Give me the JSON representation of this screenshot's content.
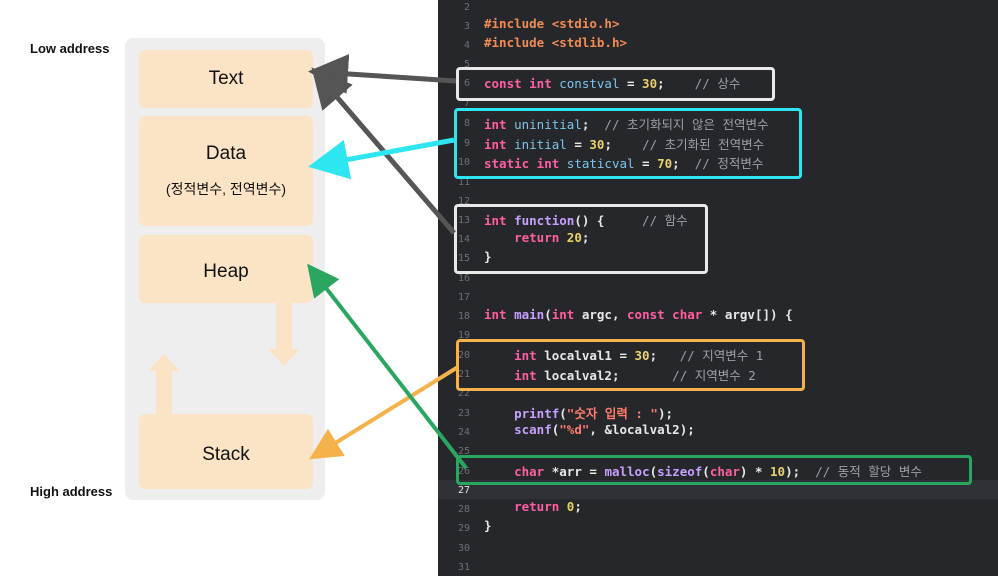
{
  "labels": {
    "low_address": "Low address",
    "high_address": "High address"
  },
  "segments": {
    "text": "Text",
    "data": "Data",
    "data_sub": "(정적변수, 전역변수)",
    "heap": "Heap",
    "stack": "Stack"
  },
  "code": {
    "line_numbers": [
      "2",
      "3",
      "4",
      "5",
      "6",
      "7",
      "8",
      "9",
      "10",
      "11",
      "12",
      "13",
      "14",
      "15",
      "16",
      "17",
      "18",
      "19",
      "20",
      "21",
      "22",
      "23",
      "24",
      "25",
      "26",
      "27",
      "28",
      "29",
      "30",
      "31"
    ],
    "include1": [
      "#include ",
      "<stdio.h>"
    ],
    "include2": [
      "#include ",
      "<stdlib.h>"
    ],
    "l6": {
      "kw": "const int",
      "var": " constval",
      "eq": " = ",
      "num": "30",
      "end": ";",
      "cm": "    // 상수"
    },
    "l8": {
      "kw": "int",
      "var": " uninitial",
      "end": ";",
      "cm": "  // 초기화되지 않은 전역변수"
    },
    "l9": {
      "kw": "int",
      "var": " initial",
      "eq": " = ",
      "num": "30",
      "end": ";",
      "cm": "    // 초기화된 전역변수"
    },
    "l10": {
      "kw": "static int",
      "var": " staticval",
      "eq": " = ",
      "num": "70",
      "end": ";",
      "cm": "  // 정적변수"
    },
    "l13": {
      "kw": "int",
      "fn": " function",
      "rest": "() {",
      "cm": "     // 함수"
    },
    "l14": {
      "kw": "return",
      "num": " 20",
      "end": ";"
    },
    "l15": "}",
    "l18": {
      "kw1": "int",
      "fn": " main",
      "p1": "(",
      "kw2": "int",
      "p2": " argc, ",
      "kw3": "const char",
      "p3": " * argv[]) {"
    },
    "l20": {
      "kw": "int",
      "rest": " localval1 = ",
      "num": "30",
      "end": ";",
      "cm": "   // 지역변수 1"
    },
    "l21": {
      "kw": "int",
      "rest": " localval2;",
      "cm": "       // 지역변수 2"
    },
    "l23": {
      "fn": "printf",
      "p1": "(",
      "str": "\"숫자 입력 : \"",
      "p2": ");"
    },
    "l24": {
      "fn": "scanf",
      "p1": "(",
      "str": "\"%d\"",
      "p2": ", &localval2);"
    },
    "l26": {
      "kw": "char",
      "rest": " *arr = ",
      "fn1": "malloc",
      "p1": "(",
      "fn2": "sizeof",
      "p2": "(",
      "kw2": "char",
      "p3": ") * ",
      "num": "10",
      "p4": ");",
      "cm": "  // 동적 할당 변수"
    },
    "l28": {
      "kw": "return",
      "num": " 0",
      "end": ";"
    },
    "l29": "}"
  },
  "colors": {
    "text_arrow": "#555555",
    "data_arrow": "#2ee6f0",
    "stack_arrow": "#f5b14a",
    "heap_arrow": "#2aa660",
    "segment_fill": "#fbe3c6"
  }
}
